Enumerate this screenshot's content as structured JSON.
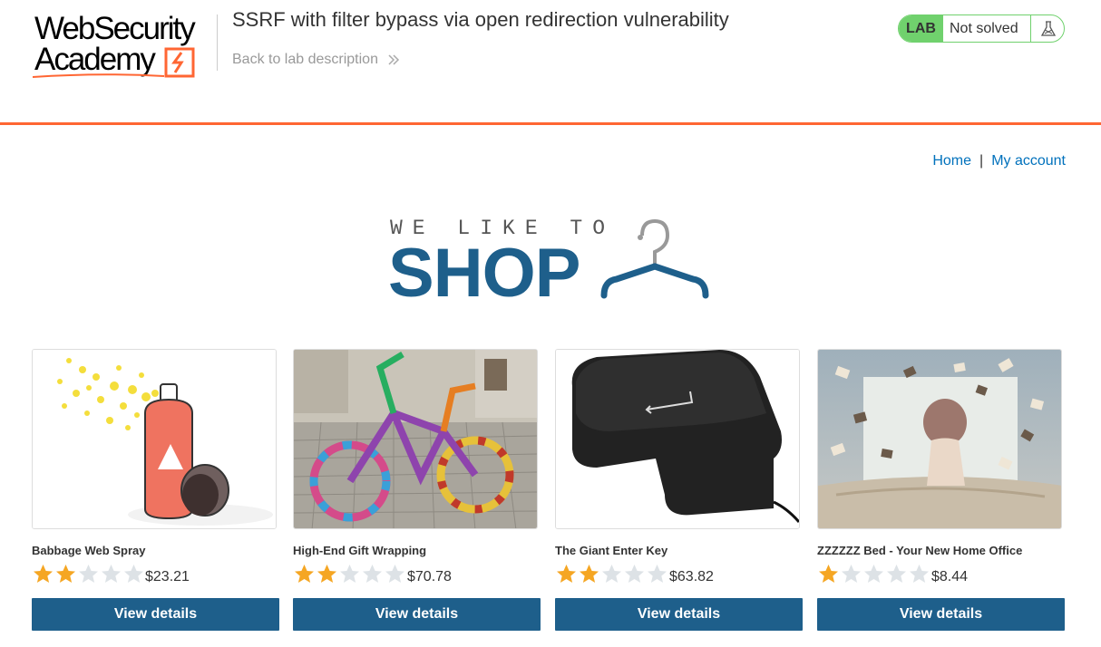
{
  "header": {
    "logo": {
      "line1": "WebSecurity",
      "line2": "Academy"
    },
    "lab_title": "SSRF with filter bypass via open redirection vulnerability",
    "back_link": "Back to lab description",
    "lab_badge": "LAB",
    "lab_status": "Not solved"
  },
  "nav": {
    "home": "Home",
    "separator": "|",
    "my_account": "My account"
  },
  "banner": {
    "small": "WE LIKE TO",
    "big": "SHOP"
  },
  "products": [
    {
      "name": "Babbage Web Spray",
      "rating": 2,
      "price": "$23.21",
      "button": "View details"
    },
    {
      "name": "High-End Gift Wrapping",
      "rating": 2,
      "price": "$70.78",
      "button": "View details"
    },
    {
      "name": "The Giant Enter Key",
      "rating": 2,
      "price": "$63.82",
      "button": "View details"
    },
    {
      "name": "ZZZZZZ Bed - Your New Home Office",
      "rating": 1,
      "price": "$8.44",
      "button": "View details"
    }
  ],
  "colors": {
    "accent": "#ff6633",
    "button": "#1e5f8b",
    "link": "#0071bc",
    "lab_green": "#70d16d",
    "star_filled": "#f5a623",
    "star_empty": "#dde2e6"
  },
  "icons": [
    "flask-icon",
    "double-chevron-right-icon",
    "hanger-icon",
    "star-icon"
  ],
  "product_images": {
    "0": {
      "alt": ""
    }
  }
}
